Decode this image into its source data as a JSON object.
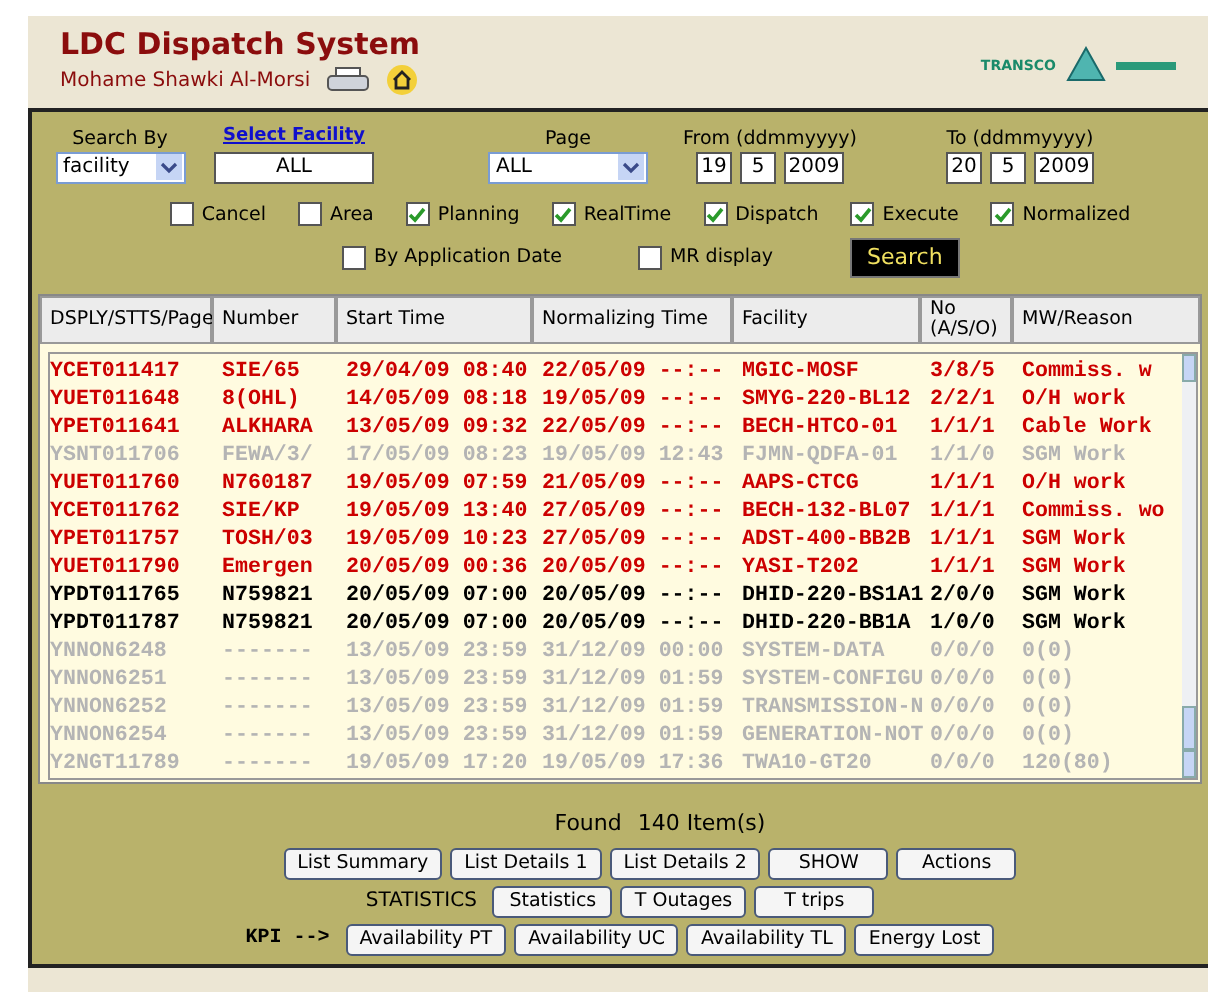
{
  "header": {
    "title": "LDC Dispatch System",
    "user": "Mohame Shawki Al-Morsi",
    "logo_text": "TRANSCO"
  },
  "filters": {
    "search_by": {
      "label": "Search By",
      "value": "facility"
    },
    "facility": {
      "label": "Select Facility",
      "value": "ALL"
    },
    "page": {
      "label": "Page",
      "value": "ALL"
    },
    "from": {
      "label": "From (ddmmyyyy)",
      "day": "19",
      "month": "5",
      "year": "2009"
    },
    "to": {
      "label": "To (ddmmyyyy)",
      "day": "20",
      "month": "5",
      "year": "2009"
    }
  },
  "checkboxes": [
    {
      "label": "Cancel",
      "checked": false
    },
    {
      "label": "Area",
      "checked": false
    },
    {
      "label": "Planning",
      "checked": true
    },
    {
      "label": "RealTime",
      "checked": true
    },
    {
      "label": "Dispatch",
      "checked": true
    },
    {
      "label": "Execute",
      "checked": true
    },
    {
      "label": "Normalized",
      "checked": true
    }
  ],
  "options": [
    {
      "label": "By Application Date",
      "checked": false
    },
    {
      "label": "MR display",
      "checked": false
    }
  ],
  "search_button": "Search",
  "table": {
    "columns": [
      "DSPLY/STTS/Page",
      "Number",
      "Start Time",
      "Normalizing Time",
      "Facility",
      "No (A/S/O)",
      "MW/Reason"
    ],
    "rows": [
      {
        "color": "#cc0000",
        "cells": [
          "YCET011417",
          "SIE/65",
          "29/04/09 08:40",
          "22/05/09 --:--",
          "MGIC-MOSF",
          "3/8/5",
          "Commiss. w"
        ]
      },
      {
        "color": "#cc0000",
        "cells": [
          "YUET011648",
          "8(OHL)",
          "14/05/09 08:18",
          "19/05/09 --:--",
          "SMYG-220-BL12",
          "2/2/1",
          "O/H work"
        ]
      },
      {
        "color": "#cc0000",
        "cells": [
          "YPET011641",
          "ALKHARA",
          "13/05/09 09:32",
          "22/05/09 --:--",
          "BECH-HTCO-01",
          "1/1/1",
          "Cable Work"
        ]
      },
      {
        "color": "#b4b4b4",
        "cells": [
          "YSNT011706",
          "FEWA/3/",
          "17/05/09 08:23",
          "19/05/09 12:43",
          "FJMN-QDFA-01",
          "1/1/0",
          "SGM Work"
        ]
      },
      {
        "color": "#cc0000",
        "cells": [
          "YUET011760",
          "N760187",
          "19/05/09 07:59",
          "21/05/09 --:--",
          "AAPS-CTCG",
          "1/1/1",
          "O/H work"
        ]
      },
      {
        "color": "#cc0000",
        "cells": [
          "YCET011762",
          "SIE/KP",
          "19/05/09 13:40",
          "27/05/09 --:--",
          "BECH-132-BL07",
          "1/1/1",
          "Commiss. wo"
        ]
      },
      {
        "color": "#cc0000",
        "cells": [
          "YPET011757",
          "TOSH/03",
          "19/05/09 10:23",
          "27/05/09 --:--",
          "ADST-400-BB2B",
          "1/1/1",
          "SGM Work"
        ]
      },
      {
        "color": "#cc0000",
        "cells": [
          "YUET011790",
          "Emergen",
          "20/05/09 00:36",
          "20/05/09 --:--",
          "YASI-T202",
          "1/1/1",
          "SGM Work"
        ]
      },
      {
        "color": "#000000",
        "cells": [
          "YPDT011765",
          "N759821",
          "20/05/09 07:00",
          "20/05/09 --:--",
          "DHID-220-BS1A1",
          "2/0/0",
          "SGM Work"
        ]
      },
      {
        "color": "#000000",
        "cells": [
          "YPDT011787",
          "N759821",
          "20/05/09 07:00",
          "20/05/09 --:--",
          "DHID-220-BB1A",
          "1/0/0",
          "SGM Work"
        ]
      },
      {
        "color": "#b4b4b4",
        "cells": [
          "YNNON6248",
          "-------",
          "13/05/09 23:59",
          "31/12/09 00:00",
          "SYSTEM-DATA",
          "0/0/0",
          "0(0)"
        ]
      },
      {
        "color": "#b4b4b4",
        "cells": [
          "YNNON6251",
          "-------",
          "13/05/09 23:59",
          "31/12/09 01:59",
          "SYSTEM-CONFIGU",
          "0/0/0",
          "0(0)"
        ]
      },
      {
        "color": "#b4b4b4",
        "cells": [
          "YNNON6252",
          "-------",
          "13/05/09 23:59",
          "31/12/09 01:59",
          "TRANSMISSION-N",
          "0/0/0",
          "0(0)"
        ]
      },
      {
        "color": "#b4b4b4",
        "cells": [
          "YNNON6254",
          "-------",
          "13/05/09 23:59",
          "31/12/09 01:59",
          "GENERATION-NOT",
          "0/0/0",
          "0(0)"
        ]
      },
      {
        "color": "#b4b4b4",
        "cells": [
          "Y2NGT11789",
          "-------",
          "19/05/09 17:20",
          "19/05/09 17:36",
          "TWA10-GT20",
          "0/0/0",
          "120(80)"
        ]
      }
    ]
  },
  "found": {
    "label": "Found",
    "count": "140 Item(s)"
  },
  "list_buttons": [
    "List Summary",
    "List Details 1",
    "List Details 2",
    "SHOW",
    "Actions"
  ],
  "statistics": {
    "label": "STATISTICS",
    "buttons": [
      "Statistics",
      "T Outages",
      "T trips"
    ]
  },
  "kpi": {
    "label": "KPI -->",
    "buttons": [
      "Availability PT",
      "Availability UC",
      "Availability TL",
      "Energy Lost"
    ]
  }
}
